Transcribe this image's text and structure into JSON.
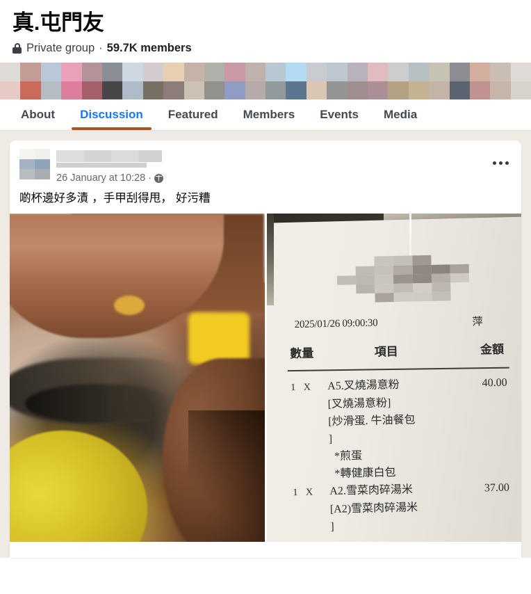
{
  "group": {
    "title": "真.屯門友",
    "privacy_icon": "lock-icon",
    "privacy_label": "Private group",
    "separator": "·",
    "members_label": "59.7K members",
    "cover_colors_row1": [
      "#dedad6",
      "#c39c96",
      "#b9c8d8",
      "#e9a0b8",
      "#b39399",
      "#8a8d93",
      "#ced8e2",
      "#d3cbd0",
      "#e7cfb3",
      "#c5b3a7",
      "#b0b0ab",
      "#c99aa6",
      "#bfb2ac",
      "#b9c7d3",
      "#b3dcf4",
      "#c9cbd0",
      "#bec6cf",
      "#b9b2bd",
      "#e0bcc0",
      "#cdcdcd",
      "#b6bfc1",
      "#c6c3b3",
      "#8b8d92",
      "#d4ae9f",
      "#c9bdb4",
      "#dedad6"
    ],
    "cover_colors_row2": [
      "#e7c9c6",
      "#c96a5b",
      "#b4bcc4",
      "#dd7f9c",
      "#a5606c",
      "#47474a",
      "#aebbc8",
      "#786f63",
      "#8c7d78",
      "#cbc2b2",
      "#92918d",
      "#8f9cc4",
      "#b6aaaa",
      "#929a9c",
      "#5c7690",
      "#dbc6b3",
      "#949492",
      "#a08d8d",
      "#ab8f97",
      "#b3a182",
      "#c4b391",
      "#c4b4a6",
      "#5c6370",
      "#c09290",
      "#c6b6a8",
      "#d8d2cc"
    ]
  },
  "tabs": [
    {
      "label": "About",
      "active": false
    },
    {
      "label": "Discussion",
      "active": true
    },
    {
      "label": "Featured",
      "active": false
    },
    {
      "label": "Members",
      "active": false
    },
    {
      "label": "Events",
      "active": false
    },
    {
      "label": "Media",
      "active": false
    }
  ],
  "tab_accent_color": "#b0551d",
  "tab_active_color": "#1877f2",
  "post": {
    "author_name_redacted": true,
    "avatar_icon": "avatar",
    "avatar_colors": [
      "#f6f4f1",
      "#f2f0ed",
      "#a5b2c3",
      "#8fa3ba",
      "#b7bcc1",
      "#a8adb2"
    ],
    "timestamp": "26 January at 10:28",
    "meta_separator": "·",
    "audience_icon": "globe-icon",
    "menu_icon": "more-options-icon",
    "text": "啲杯邊好多漬 ，手甲刮得甩， 好污糟",
    "photos": [
      {
        "alt_name": "dirty-cup-photo"
      },
      {
        "alt_name": "receipt-photo"
      }
    ]
  },
  "receipt": {
    "header_redacted": true,
    "datetime": "2025/01/26 09:00:30",
    "server": "萍",
    "col_qty": "數量",
    "col_item": "項目",
    "col_amount": "金額",
    "rows": [
      {
        "qty": "1  X",
        "name": "A5.叉燒湯意粉",
        "amount": "40.00"
      },
      {
        "sub": "[叉燒湯意粉]"
      },
      {
        "sub": "[炒滑蛋. 牛油餐包"
      },
      {
        "sub": "]"
      },
      {
        "opt": "*煎蛋"
      },
      {
        "opt": "*轉健康白包"
      },
      {
        "qty": "1  X",
        "name": "A2.雪菜肉碎湯米",
        "amount": "37.00"
      },
      {
        "sub": "[A2)雪菜肉碎湯米"
      },
      {
        "sub": "]"
      }
    ]
  },
  "background_color": "#efeae4"
}
